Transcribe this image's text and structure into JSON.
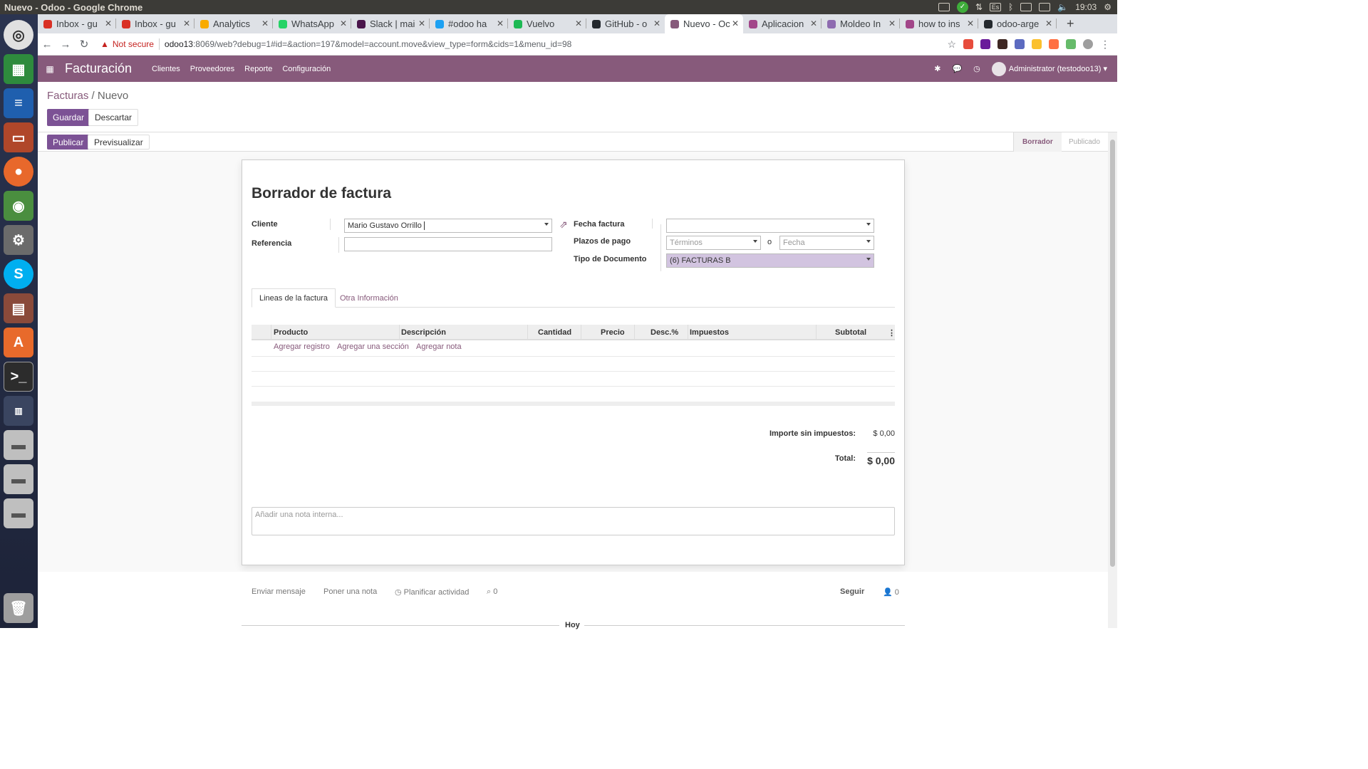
{
  "window": {
    "title": "Nuevo - Odoo - Google Chrome",
    "clock": "19:03",
    "keyboard": "Es"
  },
  "launcher": {
    "icons": [
      "ubuntu-icon",
      "spreadsheet-icon",
      "writer-icon",
      "impress-icon",
      "firefox-icon",
      "chrome-icon",
      "settings-icon",
      "skype-icon",
      "files-icon",
      "software-center-icon",
      "terminal-icon",
      "workspace-icon",
      "drive-icon",
      "drive-icon",
      "drive-icon",
      "trash-icon"
    ]
  },
  "browser": {
    "tabs": [
      {
        "label": "Inbox - gu",
        "icon": "gmail-icon",
        "color": "#d93025"
      },
      {
        "label": "Inbox - gu",
        "icon": "gmail-icon",
        "color": "#d93025"
      },
      {
        "label": "Analytics",
        "icon": "analytics-icon",
        "color": "#f9ab00"
      },
      {
        "label": "WhatsApp",
        "icon": "whatsapp-icon",
        "color": "#25d366"
      },
      {
        "label": "Slack | mai",
        "icon": "slack-icon",
        "color": "#4a154b"
      },
      {
        "label": "#odoo ha",
        "icon": "twitter-icon",
        "color": "#1da1f2"
      },
      {
        "label": "Vuelvo",
        "icon": "spotify-icon",
        "color": "#1db954"
      },
      {
        "label": "GitHub - o",
        "icon": "github-icon",
        "color": "#24292e"
      },
      {
        "label": "Nuevo - Oc",
        "icon": "odoo-icon",
        "color": "#875a7b"
      },
      {
        "label": "Aplicacion",
        "icon": "odoo-icon",
        "color": "#a24689"
      },
      {
        "label": "Moldeo In",
        "icon": "moldeo-icon",
        "color": "#8e6bb0"
      },
      {
        "label": "how to ins",
        "icon": "odoo-icon",
        "color": "#a24689"
      },
      {
        "label": "odoo-arge",
        "icon": "github-icon",
        "color": "#24292e"
      }
    ],
    "active_tab": 8,
    "security_label": "Not secure",
    "url_host": "odoo13",
    "url_rest": ":8069/web?debug=1#id=&action=197&model=account.move&view_type=form&cids=1&menu_id=98"
  },
  "odoo": {
    "brand": "Facturación",
    "menu": [
      "Clientes",
      "Proveedores",
      "Reporte",
      "Configuración"
    ],
    "user": "Administrator (testodoo13)",
    "accent": "#875a7b"
  },
  "control": {
    "breadcrumb_parent": "Facturas",
    "breadcrumb_sep": "/",
    "breadcrumb_current": "Nuevo",
    "save_label": "Guardar",
    "discard_label": "Descartar",
    "publish_label": "Publicar",
    "preview_label": "Previsualizar",
    "stages": [
      "Borrador",
      "Publicado"
    ]
  },
  "form": {
    "title": "Borrador de factura",
    "cliente_label": "Cliente",
    "cliente_value": "Mario Gustavo Orrillo",
    "referencia_label": "Referencia",
    "referencia_value": "",
    "fecha_label": "Fecha factura",
    "fecha_value": "",
    "plazos_label": "Plazos de pago",
    "terminos_placeholder": "Términos",
    "o_label": "o",
    "fecha_placeholder": "Fecha",
    "tipo_label": "Tipo de Documento",
    "tipo_value": "(6) FACTURAS B",
    "tab_lines": "Lineas de la factura",
    "tab_other": "Otra Información",
    "columns": [
      "Producto",
      "Descripción",
      "Cantidad",
      "Precio",
      "Desc.%",
      "Impuestos",
      "Subtotal"
    ],
    "add_record": "Agregar registro",
    "add_section": "Agregar una sección",
    "add_note": "Agregar nota",
    "untaxed_label": "Importe sin impuestos:",
    "untaxed_value": "$ 0,00",
    "total_label": "Total:",
    "total_value": "$ 0,00",
    "internal_note_placeholder": "Añadir una nota interna..."
  },
  "chatter": {
    "send_message": "Enviar mensaje",
    "log_note": "Poner una nota",
    "schedule": "Planificar actividad",
    "attachments": "0",
    "follow": "Seguir",
    "followers": "0",
    "today": "Hoy"
  }
}
